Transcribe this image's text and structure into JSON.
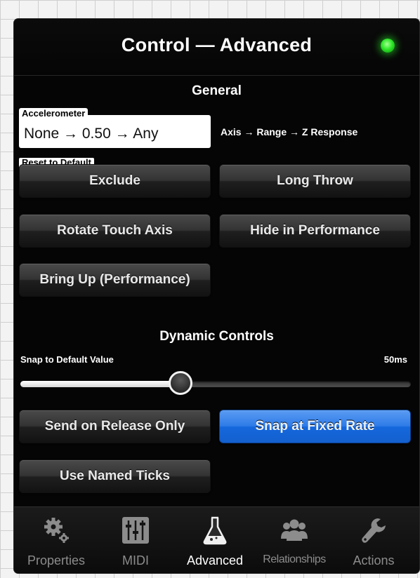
{
  "header": {
    "title": "Control — Advanced",
    "status_color": "#2fe82a"
  },
  "general": {
    "title": "General",
    "accelerometer": {
      "label": "Accelerometer",
      "value": "None → 0.50 → Any",
      "hint": "Axis → Range → Z Response"
    },
    "reset_label": "Reset to Default",
    "buttons": [
      "Exclude",
      "Long Throw",
      "Rotate Touch Axis",
      "Hide in Performance",
      "Bring Up (Performance)"
    ]
  },
  "dynamic": {
    "title": "Dynamic Controls",
    "slider": {
      "label": "Snap to Default Value",
      "value_text": "50ms",
      "fraction": 0.41
    },
    "buttons": [
      "Send on Release Only",
      "Snap at Fixed Rate",
      "Use Named Ticks"
    ],
    "selected": "Snap at Fixed Rate",
    "accent_color": "#2f7ce8"
  },
  "tabs": [
    {
      "label": "Properties",
      "icon": "gears-icon"
    },
    {
      "label": "MIDI",
      "icon": "mixer-icon"
    },
    {
      "label": "Advanced",
      "icon": "flask-icon",
      "active": true
    },
    {
      "label": "Relationships",
      "icon": "people-icon"
    },
    {
      "label": "Actions",
      "icon": "wrench-icon"
    }
  ]
}
